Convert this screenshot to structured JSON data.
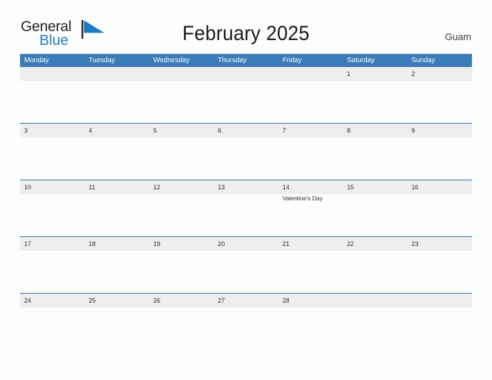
{
  "brand": {
    "name_line1": "General",
    "name_line2": "Blue",
    "flag_icon": "triangle-flag-icon",
    "color_dark": "#231f20",
    "color_blue": "#1e7ac4"
  },
  "header": {
    "title": "February 2025",
    "location": "Guam"
  },
  "theme": {
    "header_blue": "#3b7cb8",
    "rule_blue": "#2b6ca8",
    "band_gray": "#eeeeee",
    "page_bg": "#fcfdfd",
    "text_dark": "#2b2b2b"
  },
  "calendar": {
    "month": "February",
    "year": "2025",
    "weekdays": [
      "Monday",
      "Tuesday",
      "Wednesday",
      "Thursday",
      "Friday",
      "Saturday",
      "Sunday"
    ],
    "weeks": [
      [
        {
          "day": "",
          "event": ""
        },
        {
          "day": "",
          "event": ""
        },
        {
          "day": "",
          "event": ""
        },
        {
          "day": "",
          "event": ""
        },
        {
          "day": "",
          "event": ""
        },
        {
          "day": "1",
          "event": ""
        },
        {
          "day": "2",
          "event": ""
        }
      ],
      [
        {
          "day": "3",
          "event": ""
        },
        {
          "day": "4",
          "event": ""
        },
        {
          "day": "5",
          "event": ""
        },
        {
          "day": "6",
          "event": ""
        },
        {
          "day": "7",
          "event": ""
        },
        {
          "day": "8",
          "event": ""
        },
        {
          "day": "9",
          "event": ""
        }
      ],
      [
        {
          "day": "10",
          "event": ""
        },
        {
          "day": "11",
          "event": ""
        },
        {
          "day": "12",
          "event": ""
        },
        {
          "day": "13",
          "event": ""
        },
        {
          "day": "14",
          "event": "Valentine's Day"
        },
        {
          "day": "15",
          "event": ""
        },
        {
          "day": "16",
          "event": ""
        }
      ],
      [
        {
          "day": "17",
          "event": ""
        },
        {
          "day": "18",
          "event": ""
        },
        {
          "day": "19",
          "event": ""
        },
        {
          "day": "20",
          "event": ""
        },
        {
          "day": "21",
          "event": ""
        },
        {
          "day": "22",
          "event": ""
        },
        {
          "day": "23",
          "event": ""
        }
      ],
      [
        {
          "day": "24",
          "event": ""
        },
        {
          "day": "25",
          "event": ""
        },
        {
          "day": "26",
          "event": ""
        },
        {
          "day": "27",
          "event": ""
        },
        {
          "day": "28",
          "event": ""
        },
        {
          "day": "",
          "event": ""
        },
        {
          "day": "",
          "event": ""
        }
      ]
    ]
  }
}
